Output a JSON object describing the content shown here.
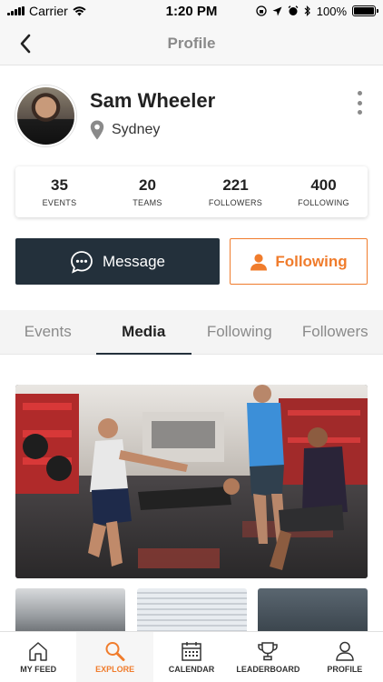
{
  "status_bar": {
    "carrier": "Carrier",
    "time": "1:20 PM",
    "battery": "100%"
  },
  "nav": {
    "title": "Profile",
    "back_icon": "chevron-left-icon"
  },
  "profile": {
    "name": "Sam Wheeler",
    "location": "Sydney",
    "more_icon": "more-vertical-icon"
  },
  "stats": [
    {
      "value": "35",
      "label": "EVENTS"
    },
    {
      "value": "20",
      "label": "TEAMS"
    },
    {
      "value": "221",
      "label": "FOLLOWERS"
    },
    {
      "value": "400",
      "label": "FOLLOWING"
    }
  ],
  "actions": {
    "message_label": "Message",
    "following_label": "Following"
  },
  "tabs": [
    {
      "label": "Events",
      "active": false
    },
    {
      "label": "Media",
      "active": true
    },
    {
      "label": "Following",
      "active": false
    },
    {
      "label": "Followers",
      "active": false
    }
  ],
  "bottom_nav": [
    {
      "label": "MY FEED",
      "icon": "home-icon",
      "active": false
    },
    {
      "label": "EXPLORE",
      "icon": "search-icon",
      "active": true
    },
    {
      "label": "CALENDAR",
      "icon": "calendar-icon",
      "active": false
    },
    {
      "label": "LEADERBOARD",
      "icon": "trophy-icon",
      "active": false
    },
    {
      "label": "PROFILE",
      "icon": "user-icon",
      "active": false
    }
  ],
  "colors": {
    "accent": "#f07c2c",
    "dark": "#23303b"
  }
}
